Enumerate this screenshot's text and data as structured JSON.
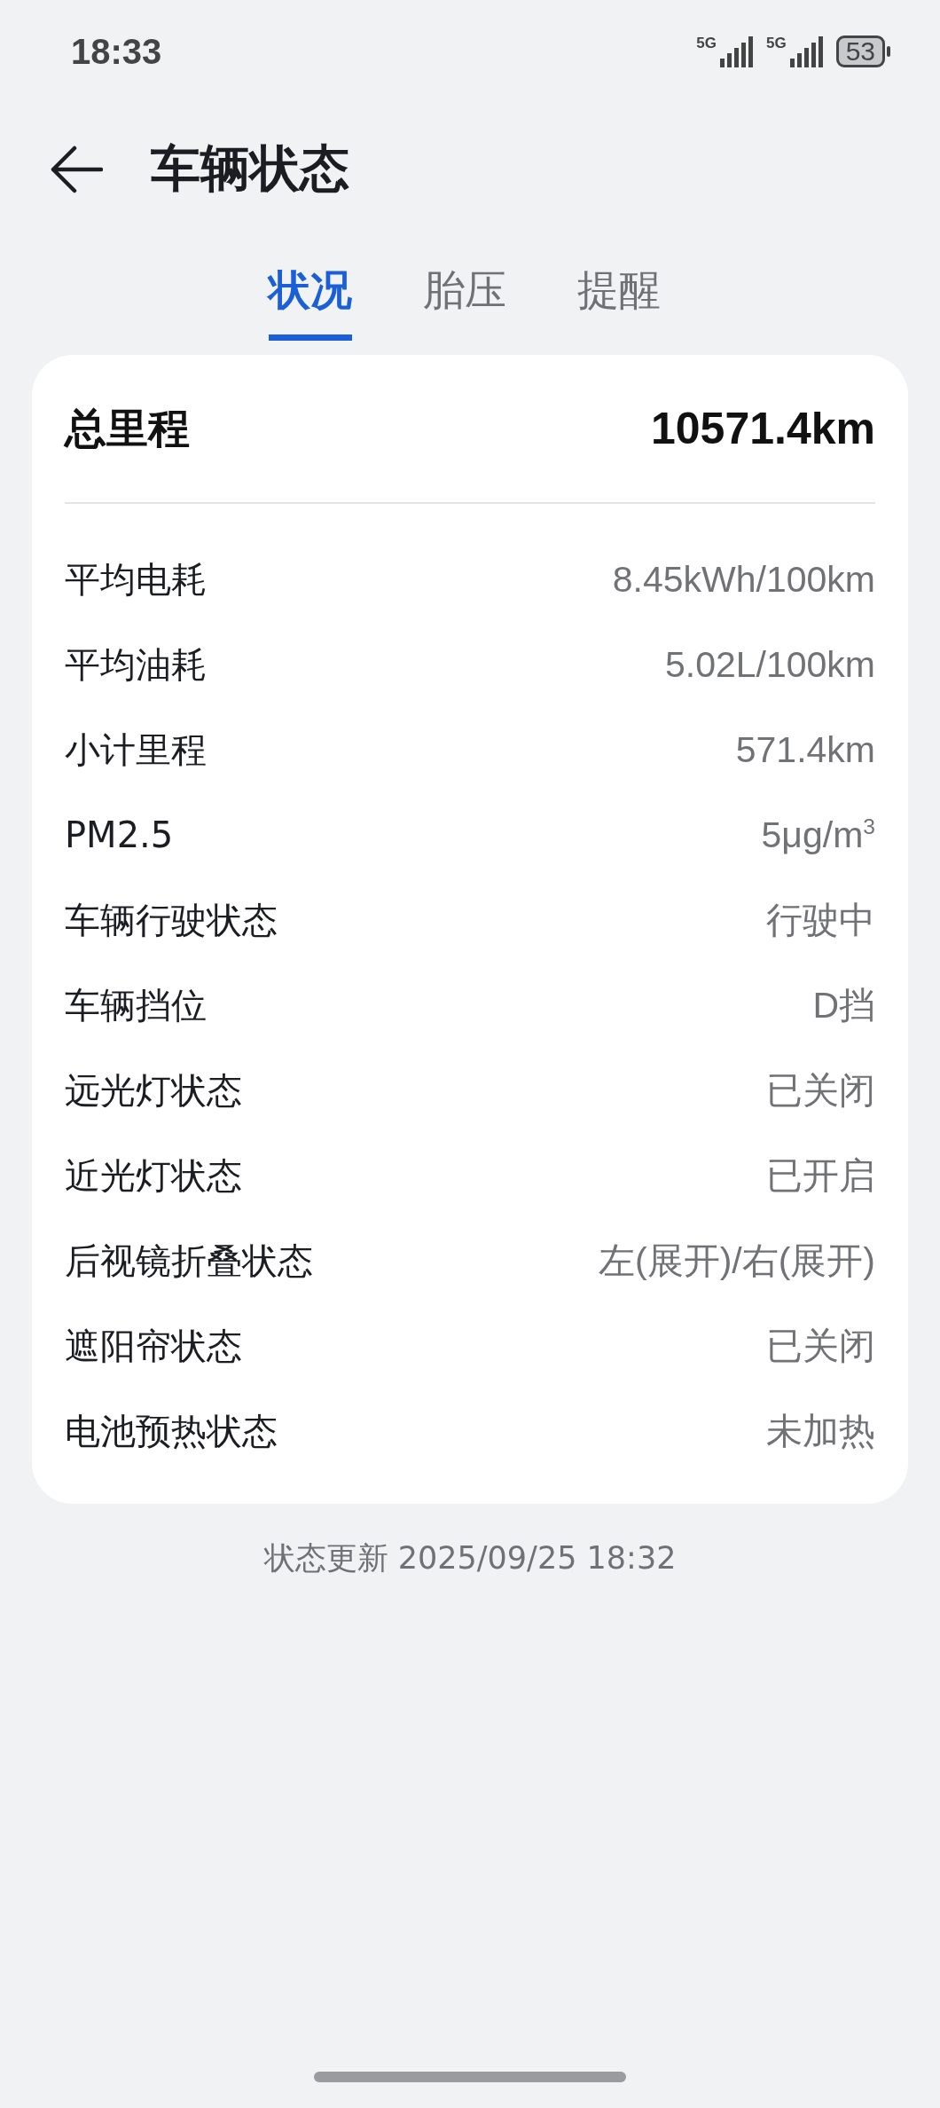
{
  "status_bar": {
    "time": "18:33",
    "signals": [
      {
        "label": "5G"
      },
      {
        "label": "5G"
      }
    ],
    "battery": "53"
  },
  "header": {
    "title": "车辆状态"
  },
  "tabs": [
    {
      "label": "状况",
      "selected": true
    },
    {
      "label": "胎压",
      "selected": false
    },
    {
      "label": "提醒",
      "selected": false
    }
  ],
  "summary": {
    "label": "总里程",
    "value": "10571.4km"
  },
  "rows": [
    {
      "label": "平均电耗",
      "value": "8.45kWh/100km"
    },
    {
      "label": "平均油耗",
      "value": "5.02L/100km"
    },
    {
      "label": "小计里程",
      "value": "571.4km"
    },
    {
      "label": "PM2.5",
      "value": "5μg/m$^{3}$"
    },
    {
      "label": "车辆行驶状态",
      "value": "行驶中"
    },
    {
      "label": "车辆挡位",
      "value": "D挡"
    },
    {
      "label": "远光灯状态",
      "value": "已关闭"
    },
    {
      "label": "近光灯状态",
      "value": "已开启"
    },
    {
      "label": "后视镜折叠状态",
      "value": "左(展开)/右(展开)"
    },
    {
      "label": "遮阳帘状态",
      "value": "已关闭"
    },
    {
      "label": "电池预热状态",
      "value": "未加热"
    }
  ],
  "footer": "状态更新 2025/09/25 18:32"
}
